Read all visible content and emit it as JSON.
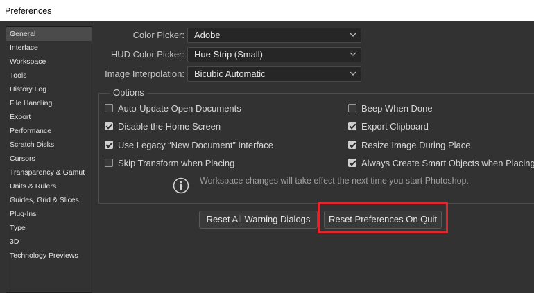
{
  "window": {
    "title": "Preferences"
  },
  "sidebar": {
    "items": [
      {
        "label": "General",
        "selected": true
      },
      {
        "label": "Interface"
      },
      {
        "label": "Workspace"
      },
      {
        "label": "Tools"
      },
      {
        "label": "History Log"
      },
      {
        "label": "File Handling"
      },
      {
        "label": "Export"
      },
      {
        "label": "Performance"
      },
      {
        "label": "Scratch Disks"
      },
      {
        "label": "Cursors"
      },
      {
        "label": "Transparency & Gamut"
      },
      {
        "label": "Units & Rulers"
      },
      {
        "label": "Guides, Grid & Slices"
      },
      {
        "label": "Plug-Ins"
      },
      {
        "label": "Type"
      },
      {
        "label": "3D"
      },
      {
        "label": "Technology Previews"
      }
    ]
  },
  "settings": {
    "color_picker": {
      "label": "Color Picker:",
      "value": "Adobe"
    },
    "hud_color_picker": {
      "label": "HUD Color Picker:",
      "value": "Hue Strip (Small)"
    },
    "image_interpolation": {
      "label": "Image Interpolation:",
      "value": "Bicubic Automatic"
    }
  },
  "options": {
    "title": "Options",
    "left": [
      {
        "label": "Auto-Update Open Documents",
        "checked": false
      },
      {
        "label": "Disable the Home Screen",
        "checked": true
      },
      {
        "label": "Use Legacy “New Document” Interface",
        "checked": true
      },
      {
        "label": "Skip Transform when Placing",
        "checked": false
      }
    ],
    "right": [
      {
        "label": "Beep When Done",
        "checked": false
      },
      {
        "label": "Export Clipboard",
        "checked": true
      },
      {
        "label": "Resize Image During Place",
        "checked": true
      },
      {
        "label": "Always Create Smart Objects when Placing",
        "checked": true
      }
    ],
    "info_text": "Workspace changes will take effect the next time you start Photoshop."
  },
  "buttons": {
    "reset_warnings": "Reset All Warning Dialogs",
    "reset_prefs": "Reset Preferences On Quit"
  },
  "colors": {
    "highlight": "#e0262e",
    "panel": "#323232",
    "field": "#262626"
  }
}
